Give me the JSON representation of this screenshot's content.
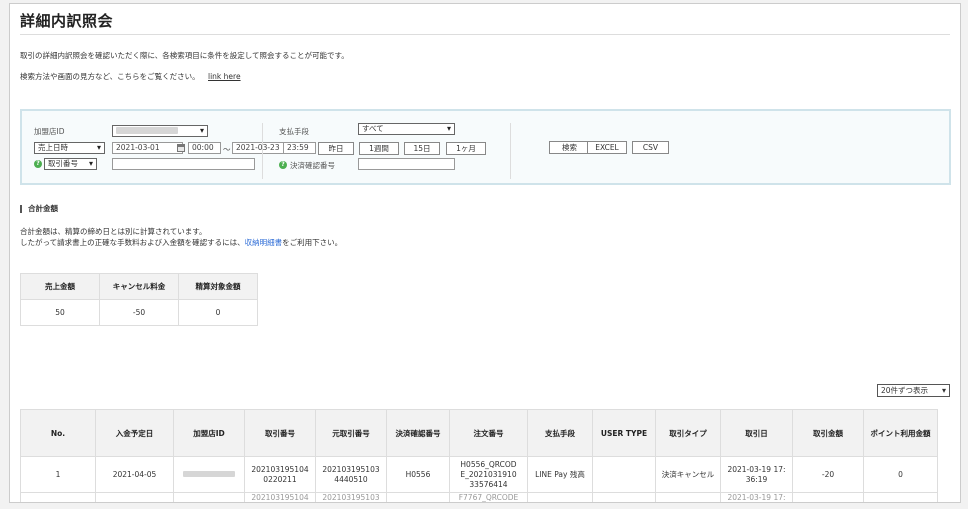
{
  "page": {
    "title": "詳細内訳照会",
    "desc1": "取引の詳細内訳照会を確認いただく際に、各検索項目に条件を設定して照会することが可能です。",
    "desc2": "検索方法や画面の見方など、こちらをご覧ください。",
    "link": "link here"
  },
  "search": {
    "merchant_label": "加盟店ID",
    "date_type": "売上日時",
    "date_from": "2021-03-01",
    "time_from": "00:00",
    "dash": "～",
    "date_to": "2021-03-23",
    "time_to": "23:59",
    "q_yesterday": "昨日",
    "q_week": "1週間",
    "q_15d": "15日",
    "q_month": "1ヶ月",
    "txn_no_type": "取引番号",
    "payment_label": "支払手段",
    "payment_value": "すべて",
    "confirm_label": "決済確認番号",
    "search_btn": "検索",
    "excel_btn": "EXCEL",
    "csv_btn": "CSV"
  },
  "totals": {
    "title": "合計金額",
    "note1": "合計金額は、精算の締め日とは別に計算されています。",
    "note2_pre": "したがって請求書上の正確な手数料および入金額を確認するには、",
    "note2_link": "収納明細書",
    "note2_post": "をご利用下さい。",
    "headers": [
      "売上金額",
      "キャンセル料金",
      "精算対象金額"
    ],
    "values": [
      "50",
      "-50",
      "0"
    ]
  },
  "pager": {
    "label": "20件ずつ表示"
  },
  "table": {
    "headers": [
      "No.",
      "入金予定日",
      "加盟店ID",
      "取引番号",
      "元取引番号",
      "決済確認番号",
      "注文番号",
      "支払手段",
      "USER TYPE",
      "取引タイプ",
      "取引日",
      "取引金額",
      "ポイント利用金額"
    ],
    "rows": [
      {
        "no": "1",
        "deposit": "2021-04-05",
        "txn_a": "202103195104",
        "txn_b": "0220211",
        "orig_a": "202103195103",
        "orig_b": "4440510",
        "confirm": "H0556",
        "order_a": "H0556_QRCOD",
        "order_b": "E_2021031910",
        "order_c": "33576414",
        "pay": "LINE Pay 残高",
        "user_type": "",
        "txn_type": "決済キャンセル",
        "date_a": "2021-03-19 17:",
        "date_b": "36:19",
        "amount": "-20",
        "points": "0"
      }
    ],
    "partial_row": {
      "txn": "202103195104",
      "orig": "202103195103",
      "order": "F7767_QRCODE",
      "date": "2021-03-19 17:"
    }
  }
}
